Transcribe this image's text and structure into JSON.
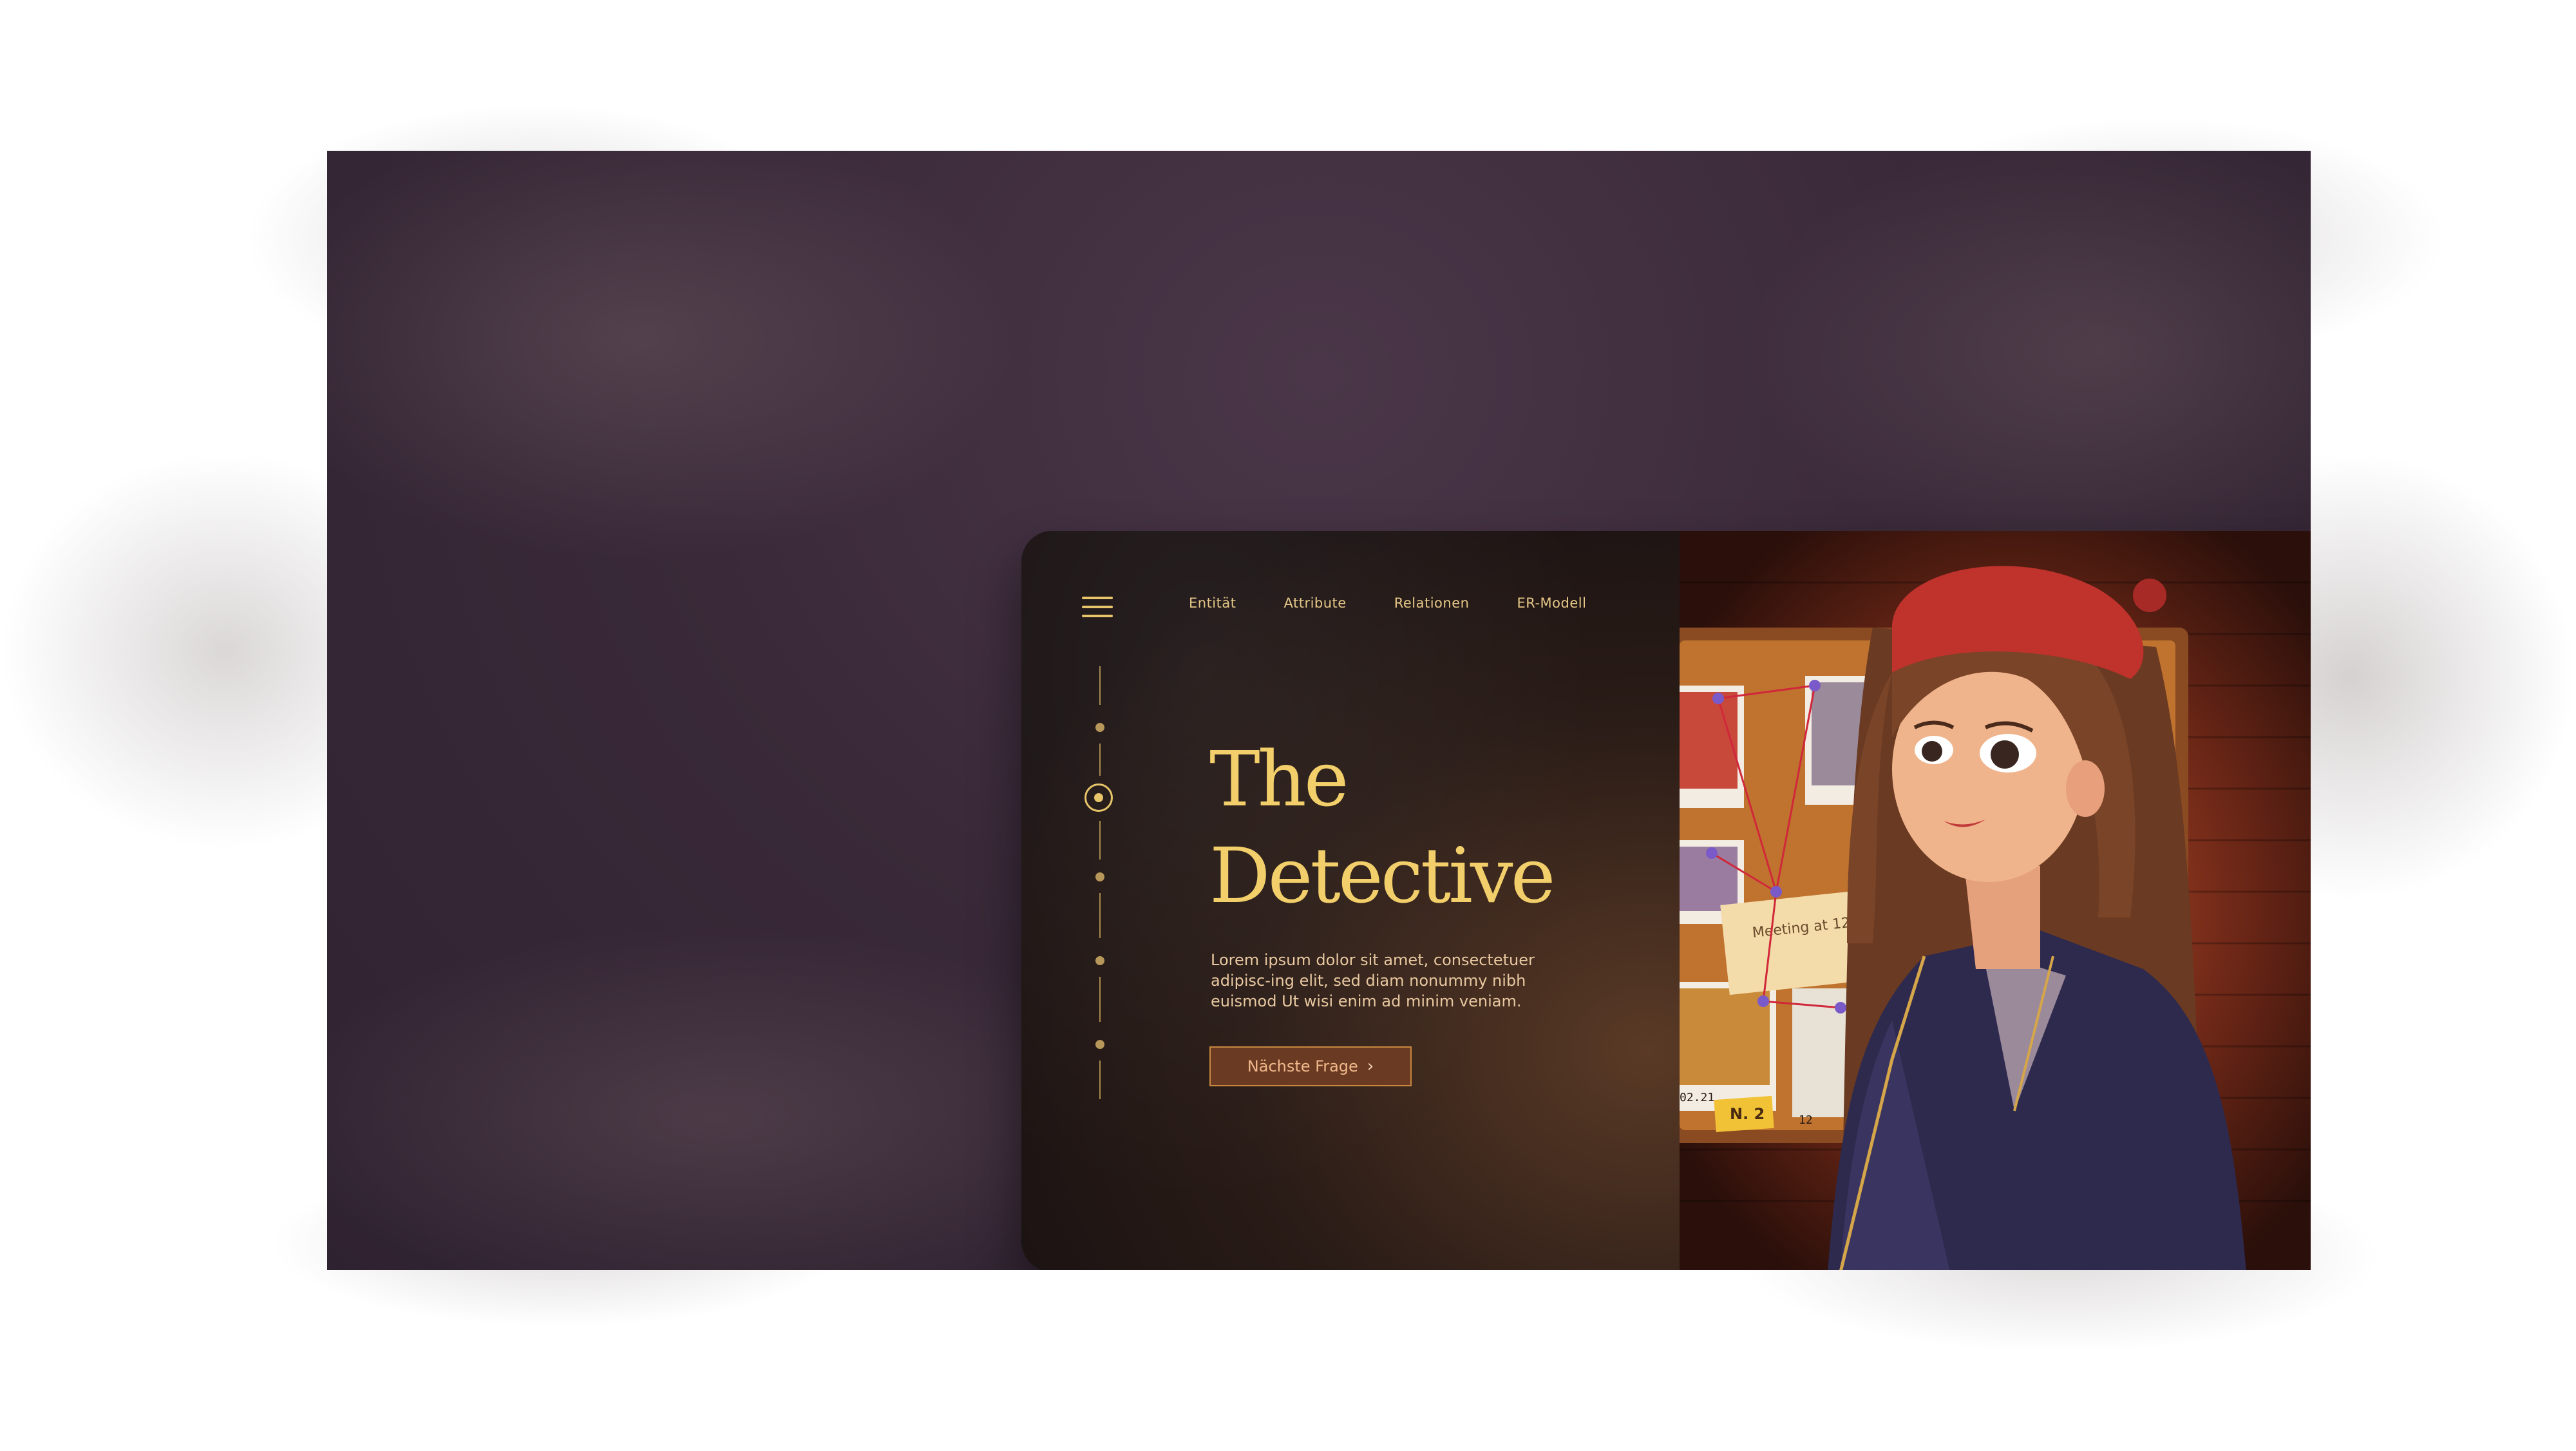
{
  "nav": {
    "items": [
      "Entität",
      "Attribute",
      "Relationen",
      "ER-Modell"
    ]
  },
  "hero": {
    "title_line1": "The",
    "title_line2": "Detective",
    "description": "Lorem ipsum dolor sit amet, consectetuer adipisc-ing elit, sed diam nonummy nibh euismod Ut wisi enim ad minim veniam.",
    "cta_label": "Nächste Frage",
    "cta_icon": "chevron-right-icon"
  },
  "stepper": {
    "steps": 5,
    "active_step": 1
  },
  "illustration": {
    "board_note": "Meeting at 12:00",
    "evidence_tag": "N. 2",
    "photo_date": "02.21",
    "photo_number": "12"
  },
  "colors": {
    "accent_gold": "#f2cf6a",
    "card_dark": "#1a1313",
    "frame_purple": "#3a2a39",
    "cta_fill": "#6a3a23",
    "beret_red": "#c0322c",
    "brick_red": "#6a2616"
  }
}
